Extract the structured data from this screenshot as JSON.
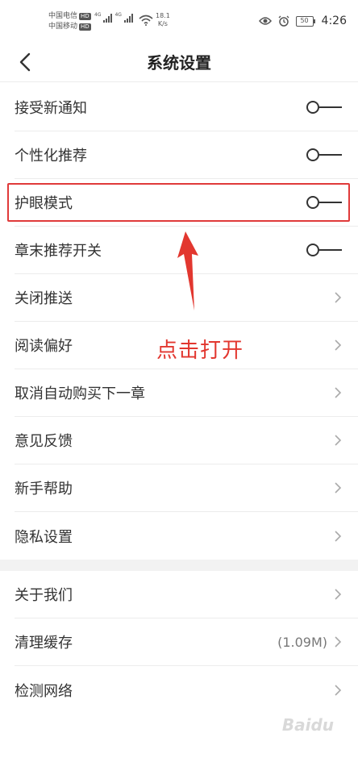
{
  "status_bar": {
    "carrier_1": "中国电信",
    "carrier_2": "中国移动",
    "hd_label": "HD",
    "signal_1_type": "4G",
    "signal_2_type": "4G",
    "net_speed_value": "18.1",
    "net_speed_unit": "K/s",
    "battery": "50",
    "time": "4:26"
  },
  "header": {
    "title": "系统设置"
  },
  "settings": {
    "items": [
      {
        "label": "接受新通知",
        "control": "toggle",
        "on": false
      },
      {
        "label": "个性化推荐",
        "control": "toggle",
        "on": false
      },
      {
        "label": "护眼模式",
        "control": "toggle",
        "on": false
      },
      {
        "label": "章末推荐开关",
        "control": "toggle",
        "on": false
      },
      {
        "label": "关闭推送",
        "control": "chevron"
      },
      {
        "label": "阅读偏好",
        "control": "chevron"
      },
      {
        "label": "取消自动购买下一章",
        "control": "chevron"
      },
      {
        "label": "意见反馈",
        "control": "chevron"
      },
      {
        "label": "新手帮助",
        "control": "chevron"
      },
      {
        "label": "隐私设置",
        "control": "chevron"
      }
    ]
  },
  "about": {
    "items": [
      {
        "label": "关于我们",
        "control": "chevron"
      },
      {
        "label": "清理缓存",
        "control": "chevron",
        "value": "(1.09M)"
      },
      {
        "label": "检测网络",
        "control": "chevron"
      }
    ]
  },
  "annotation": {
    "text": "点击打开",
    "color": "#e2372f"
  },
  "watermark": {
    "text": "Baidu"
  }
}
